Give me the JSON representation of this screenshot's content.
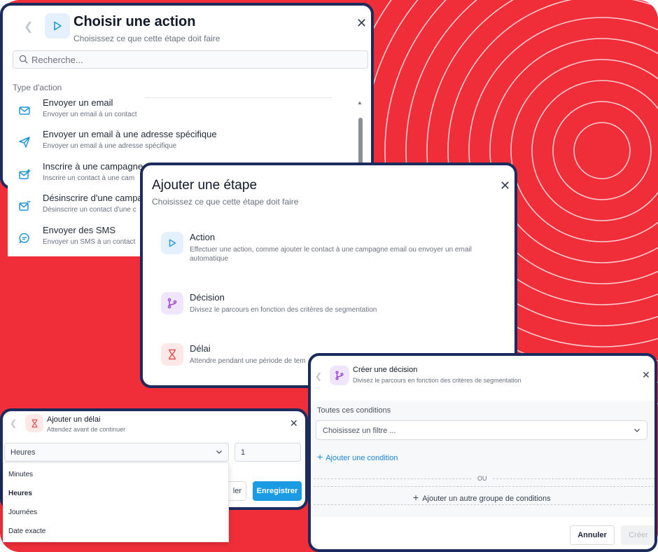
{
  "colors": {
    "background_red": "#ef2e3a",
    "card_border": "#1c2a5c",
    "primary_blue": "#1b9be4",
    "link_blue": "#1b86d6",
    "action_icon_blue": "#2196d3",
    "decision_icon_purple": "#9b3fd6",
    "delay_icon_red": "#e84c4c"
  },
  "choose_action": {
    "title": "Choisir une action",
    "subtitle": "Choisissez ce que cette étape doit faire",
    "back_icon": "chevron-left-icon",
    "header_icon": "play-icon",
    "close_icon": "close-icon",
    "search_placeholder": "Recherche...",
    "section_label": "Type d'action",
    "items": [
      {
        "title": "Envoyer un email",
        "desc": "Envoyer un email à un contact",
        "icon": "mail-icon"
      },
      {
        "title": "Envoyer un email à une adresse spécifique",
        "desc": "Envoyer un email à une adresse spécifique",
        "icon": "send-icon"
      },
      {
        "title": "Inscrire à une campagne",
        "desc": "Inscrire un contact à une cam",
        "icon": "mail-plus-icon"
      },
      {
        "title": "Désinscrire d'une campag",
        "desc": "Désinscrire un contact d'une c",
        "icon": "mail-minus-icon"
      },
      {
        "title": "Envoyer des SMS",
        "desc": "Envoyer un SMS à un contact",
        "icon": "message-icon"
      }
    ]
  },
  "add_step": {
    "title": "Ajouter une étape",
    "subtitle": "Choisissez ce que cette étape doit faire",
    "close_icon": "close-icon",
    "options": [
      {
        "title": "Action",
        "desc": "Effectuer une action, comme ajouter le contact à une campagne email ou envoyer un email automatique",
        "icon": "play-icon"
      },
      {
        "title": "Décision",
        "desc": "Divisez le parcours en fonction des critères de segmentation",
        "icon": "branch-icon"
      },
      {
        "title": "Délai",
        "desc": "Attendre pendant une période de tem",
        "icon": "hourglass-icon"
      }
    ]
  },
  "add_delay": {
    "title": "Ajouter un délai",
    "subtitle": "Attendez avant de continuer",
    "unit_selected": "Heures",
    "quantity": "1",
    "cancel_partial": "ler",
    "save_label": "Enregistrer",
    "dropdown_options": [
      "Minutes",
      "Heures",
      "Journées",
      "Date exacte"
    ]
  },
  "create_decision": {
    "title": "Créer une décision",
    "subtitle": "Divisez le parcours en fonction des critères de segmentation",
    "conditions_label": "Toutes ces conditions",
    "filter_placeholder": "Choisissez un filtre ...",
    "add_condition": "Ajouter une condition",
    "or_label": "OU",
    "add_group": "Ajouter un autre groupe de conditions",
    "cancel_label": "Annuler",
    "create_label": "Créer"
  }
}
